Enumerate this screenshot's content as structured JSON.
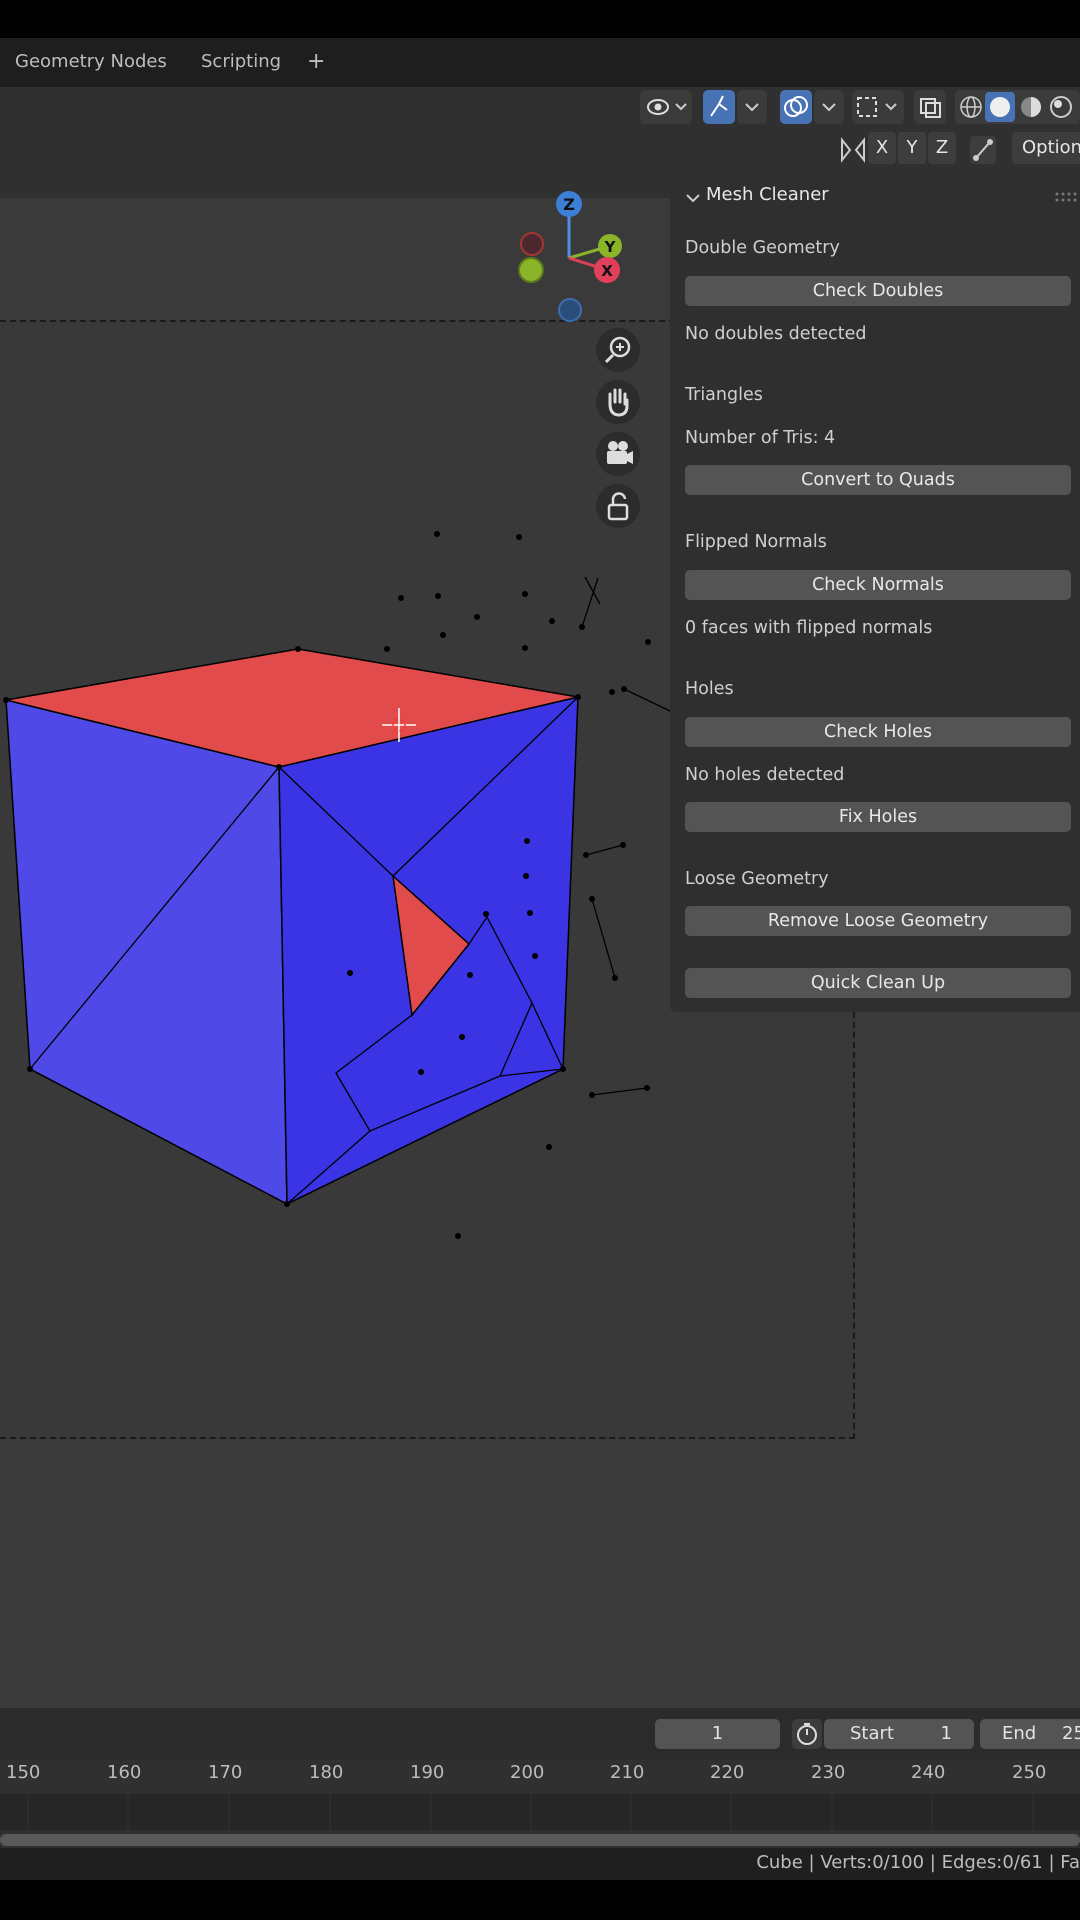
{
  "workspace_tabs": [
    "Geometry Nodes",
    "Scripting"
  ],
  "add_workspace": "+",
  "axis_toggles": [
    "X",
    "Y",
    "Z"
  ],
  "options_label": "Option",
  "gizmo": {
    "z": "Z",
    "y": "Y",
    "x": "X"
  },
  "panel": {
    "title": "Mesh Cleaner",
    "double_geometry": {
      "heading": "Double Geometry",
      "button": "Check Doubles",
      "status": "No doubles detected"
    },
    "triangles": {
      "heading": "Triangles",
      "count": "Number of Tris: 4",
      "button": "Convert to Quads"
    },
    "flipped_normals": {
      "heading": "Flipped Normals",
      "button": "Check Normals",
      "status": "0 faces with flipped normals"
    },
    "holes": {
      "heading": "Holes",
      "check_button": "Check Holes",
      "status": "No holes detected",
      "fix_button": "Fix Holes"
    },
    "loose_geometry": {
      "heading": "Loose Geometry",
      "button": "Remove Loose Geometry"
    },
    "quick_clean": "Quick Clean Up"
  },
  "timeline": {
    "current_frame": "1",
    "start_label": "Start",
    "start_value": "1",
    "end_label": "End",
    "end_value": "25",
    "ticks": [
      "150",
      "160",
      "170",
      "180",
      "190",
      "200",
      "210",
      "220",
      "230",
      "240",
      "250"
    ]
  },
  "status_bar": "Cube | Verts:0/100 | Edges:0/61 | Fa",
  "colors": {
    "face_blue": "#3b35e6",
    "face_red": "#e24a4a",
    "active_button": "#4772b3"
  }
}
